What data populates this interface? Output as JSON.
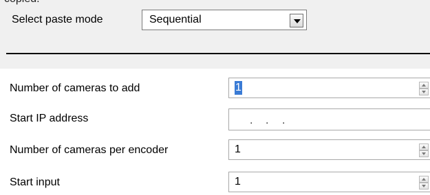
{
  "header_partial": "copied.",
  "paste_mode": {
    "label": "Select paste mode",
    "selected": "Sequential"
  },
  "fields": {
    "num_cameras": {
      "label": "Number of cameras to add",
      "value": "1"
    },
    "start_ip": {
      "label": "Start IP address",
      "octets": [
        "",
        "",
        "",
        ""
      ],
      "separator": "."
    },
    "cameras_per_encoder": {
      "label": "Number of cameras per encoder",
      "value": "1"
    },
    "start_input": {
      "label": "Start input",
      "value": "1"
    }
  },
  "icons": {
    "dropdown": "chevron-down-icon",
    "spin_up": "arrow-up-icon",
    "spin_down": "arrow-down-icon"
  },
  "colors": {
    "panel_background": "#f0f0f0",
    "selection": "#3a7bd5"
  }
}
